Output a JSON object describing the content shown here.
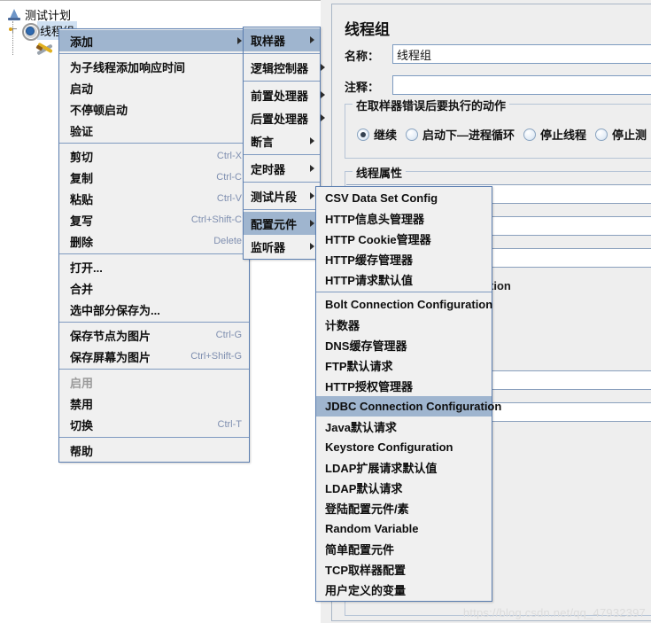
{
  "tree": {
    "nodes": [
      {
        "label": "测试计划",
        "icon": "test-plan-icon",
        "selected": false
      },
      {
        "label": "线程组",
        "icon": "thread-group-gear-icon",
        "selected": true
      },
      {
        "label": "",
        "icon": "workbench-tools-icon",
        "selected": false
      }
    ]
  },
  "right_panel": {
    "title": "线程组",
    "name_label": "名称：",
    "name_value": "线程组",
    "comment_label": "注释：",
    "comment_value": "",
    "comment_placeholder": "",
    "error_group_legend": "在取样器错误后要执行的动作",
    "error_options": [
      {
        "label": "继续",
        "selected": true
      },
      {
        "label": "启动下—进程循环",
        "selected": false
      },
      {
        "label": "停止线程",
        "selected": false
      },
      {
        "label": "停止测",
        "selected": false
      }
    ],
    "thread_props_legend": "线程属性",
    "fragment_text": "tion"
  },
  "context_menu": {
    "items": [
      {
        "label": "添加",
        "accel": "",
        "submenu": true,
        "highlight": true,
        "disabled": false
      },
      {
        "separator": true
      },
      {
        "label": "为子线程添加响应时间",
        "accel": "",
        "submenu": false,
        "highlight": false,
        "disabled": false
      },
      {
        "label": "启动",
        "accel": "",
        "submenu": false,
        "highlight": false,
        "disabled": false
      },
      {
        "label": "不停顿启动",
        "accel": "",
        "submenu": false,
        "highlight": false,
        "disabled": false
      },
      {
        "label": "验证",
        "accel": "",
        "submenu": false,
        "highlight": false,
        "disabled": false
      },
      {
        "separator": true
      },
      {
        "label": "剪切",
        "accel": "Ctrl-X",
        "submenu": false,
        "highlight": false,
        "disabled": false
      },
      {
        "label": "复制",
        "accel": "Ctrl-C",
        "submenu": false,
        "highlight": false,
        "disabled": false
      },
      {
        "label": "粘贴",
        "accel": "Ctrl-V",
        "submenu": false,
        "highlight": false,
        "disabled": false
      },
      {
        "label": "复写",
        "accel": "Ctrl+Shift-C",
        "submenu": false,
        "highlight": false,
        "disabled": false
      },
      {
        "label": "删除",
        "accel": "Delete",
        "submenu": false,
        "highlight": false,
        "disabled": false
      },
      {
        "separator": true
      },
      {
        "label": "打开...",
        "accel": "",
        "submenu": false,
        "highlight": false,
        "disabled": false
      },
      {
        "label": "合并",
        "accel": "",
        "submenu": false,
        "highlight": false,
        "disabled": false
      },
      {
        "label": "选中部分保存为...",
        "accel": "",
        "submenu": false,
        "highlight": false,
        "disabled": false
      },
      {
        "separator": true
      },
      {
        "label": "保存节点为图片",
        "accel": "Ctrl-G",
        "submenu": false,
        "highlight": false,
        "disabled": false
      },
      {
        "label": "保存屏幕为图片",
        "accel": "Ctrl+Shift-G",
        "submenu": false,
        "highlight": false,
        "disabled": false
      },
      {
        "separator": true
      },
      {
        "label": "启用",
        "accel": "",
        "submenu": false,
        "highlight": false,
        "disabled": true
      },
      {
        "label": "禁用",
        "accel": "",
        "submenu": false,
        "highlight": false,
        "disabled": false
      },
      {
        "label": "切换",
        "accel": "Ctrl-T",
        "submenu": false,
        "highlight": false,
        "disabled": false
      },
      {
        "separator": true
      },
      {
        "label": "帮助",
        "accel": "",
        "submenu": false,
        "highlight": false,
        "disabled": false
      }
    ]
  },
  "add_submenu": {
    "items": [
      {
        "label": "取样器",
        "submenu": true,
        "highlight": true
      },
      {
        "separator": true
      },
      {
        "label": "逻辑控制器",
        "submenu": true,
        "highlight": false
      },
      {
        "separator": true
      },
      {
        "label": "前置处理器",
        "submenu": true,
        "highlight": false
      },
      {
        "label": "后置处理器",
        "submenu": true,
        "highlight": false
      },
      {
        "label": "断言",
        "submenu": true,
        "highlight": false
      },
      {
        "separator": true
      },
      {
        "label": "定时器",
        "submenu": true,
        "highlight": false
      },
      {
        "separator": true
      },
      {
        "label": "测试片段",
        "submenu": true,
        "highlight": false
      },
      {
        "separator": true
      },
      {
        "label": "配置元件",
        "submenu": true,
        "highlight": true
      },
      {
        "label": "监听器",
        "submenu": true,
        "highlight": false
      }
    ]
  },
  "config_submenu": {
    "items": [
      {
        "label": "CSV Data Set Config",
        "highlight": false
      },
      {
        "label": "HTTP信息头管理器",
        "highlight": false
      },
      {
        "label": "HTTP Cookie管理器",
        "highlight": false
      },
      {
        "label": "HTTP缓存管理器",
        "highlight": false
      },
      {
        "label": "HTTP请求默认值",
        "highlight": false
      },
      {
        "separator": true
      },
      {
        "label": "Bolt Connection Configuration",
        "highlight": false
      },
      {
        "label": "计数器",
        "highlight": false
      },
      {
        "label": "DNS缓存管理器",
        "highlight": false
      },
      {
        "label": "FTP默认请求",
        "highlight": false
      },
      {
        "label": "HTTP授权管理器",
        "highlight": false
      },
      {
        "label": "JDBC Connection Configuration",
        "highlight": true
      },
      {
        "label": "Java默认请求",
        "highlight": false
      },
      {
        "label": "Keystore Configuration",
        "highlight": false
      },
      {
        "label": "LDAP扩展请求默认值",
        "highlight": false
      },
      {
        "label": "LDAP默认请求",
        "highlight": false
      },
      {
        "label": "登陆配置元件/素",
        "highlight": false
      },
      {
        "label": "Random Variable",
        "highlight": false
      },
      {
        "label": "简单配置元件",
        "highlight": false
      },
      {
        "label": "TCP取样器配置",
        "highlight": false
      },
      {
        "label": "用户定义的变量",
        "highlight": false
      }
    ]
  },
  "watermark": {
    "text": "https://blog.csdn.net/qq_47932397"
  },
  "colors": {
    "menu_bg": "#f0f0f0",
    "menu_border": "#5b7eb0",
    "highlight": "#9fb5cf",
    "accel": "#7f8fb0",
    "panel_bg": "#eeeeee",
    "selection": "#cfe0f2"
  }
}
